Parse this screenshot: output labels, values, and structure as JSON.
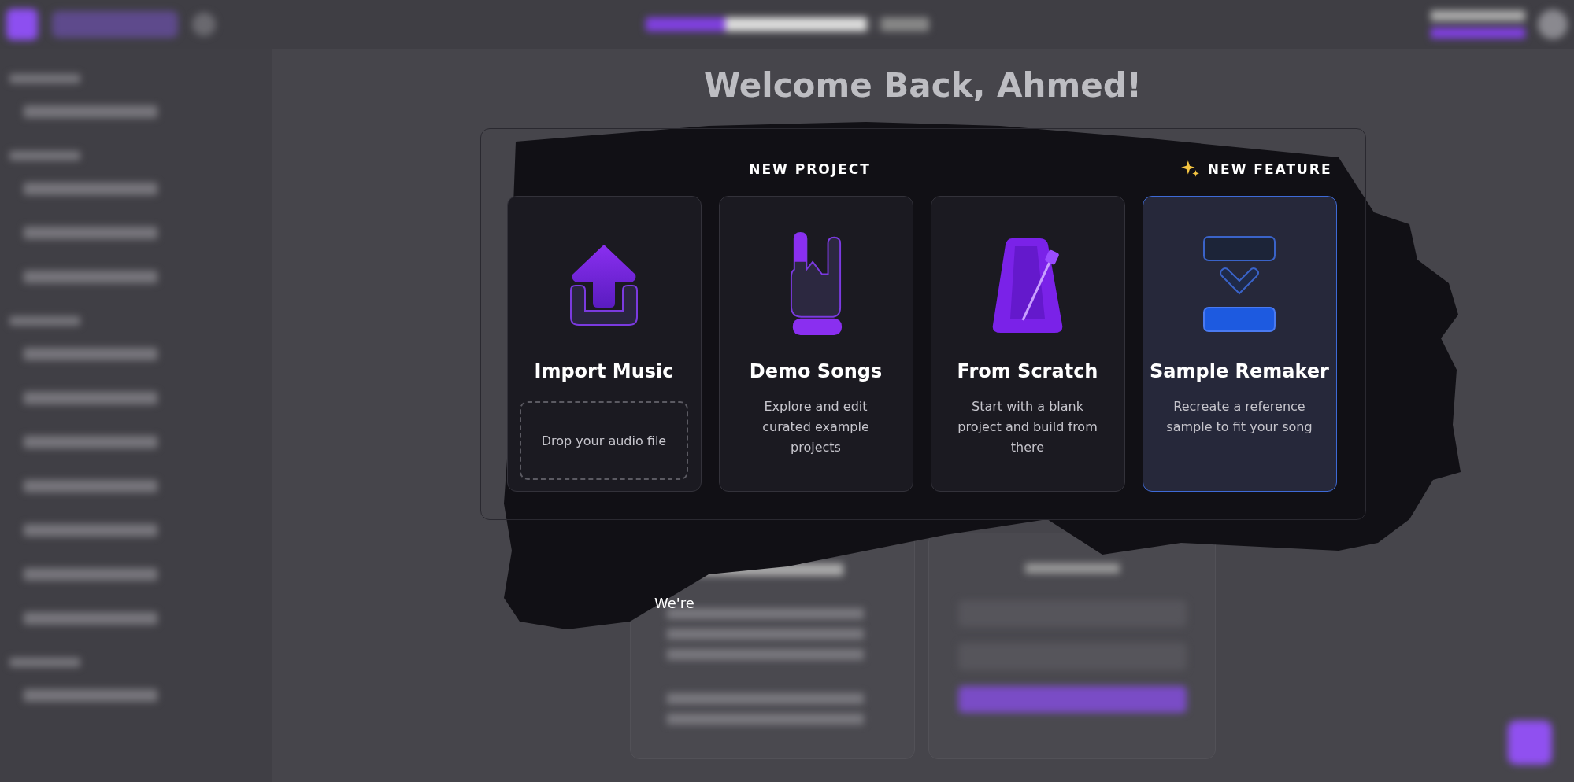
{
  "header": {
    "greeting": "Welcome Back, Ahmed!"
  },
  "new_project": {
    "title": "NEW PROJECT",
    "feature_label": "NEW FEATURE",
    "cards": [
      {
        "kind": "import",
        "title": "Import Music",
        "drop_zone": "Drop your audio file",
        "selected": false
      },
      {
        "kind": "demo",
        "title": "Demo Songs",
        "description": "Explore and edit curated example projects",
        "selected": false
      },
      {
        "kind": "scratch",
        "title": "From Scratch",
        "description": "Start with a blank project and build from there",
        "selected": false
      },
      {
        "kind": "remaker",
        "title": "Sample Remaker",
        "description": "Recreate a reference sample to fit your song",
        "selected": true
      }
    ]
  },
  "news_card": {
    "text_fragment": "We're"
  }
}
